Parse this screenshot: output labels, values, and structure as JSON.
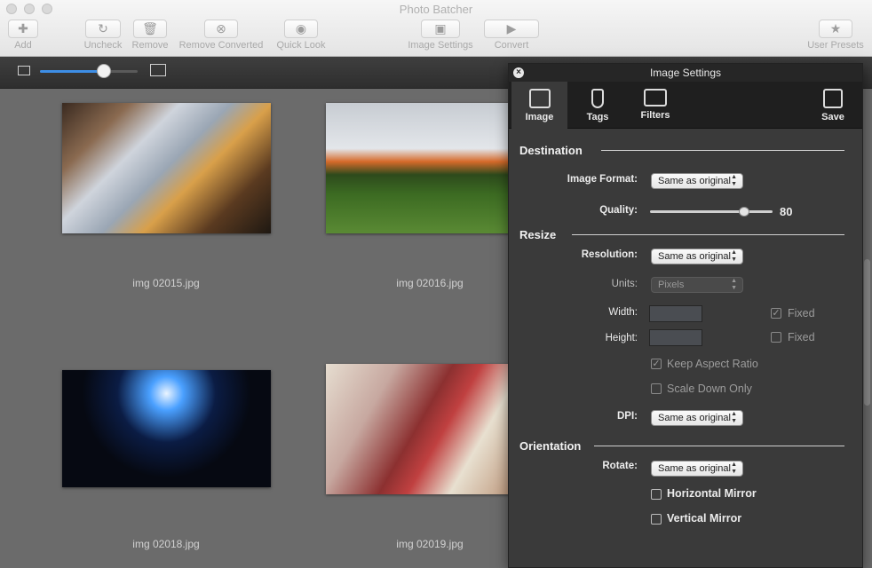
{
  "window": {
    "title": "Photo Batcher"
  },
  "toolbar": {
    "add": "Add",
    "uncheck": "Uncheck",
    "remove": "Remove",
    "remove_converted": "Remove Converted",
    "quick_look": "Quick Look",
    "image_settings": "Image Settings",
    "convert": "Convert",
    "user_presets": "User Presets"
  },
  "zoom": {
    "level": 0.65
  },
  "images": [
    {
      "name": "img 02015.jpg"
    },
    {
      "name": "img 02016.jpg"
    },
    {
      "name": "img 02018.jpg"
    },
    {
      "name": "img 02019.jpg"
    }
  ],
  "panel": {
    "title": "Image Settings",
    "tabs": {
      "image": "Image",
      "tags": "Tags",
      "filters": "Filters",
      "save": "Save"
    },
    "destination": {
      "heading": "Destination",
      "format_label": "Image Format:",
      "format_value": "Same as original",
      "quality_label": "Quality:",
      "quality_value": "80"
    },
    "resize": {
      "heading": "Resize",
      "resolution_label": "Resolution:",
      "resolution_value": "Same as original",
      "units_label": "Units:",
      "units_value": "Pixels",
      "width_label": "Width:",
      "height_label": "Height:",
      "fixed_label": "Fixed",
      "keep_aspect": "Keep Aspect Ratio",
      "scale_down": "Scale Down Only",
      "dpi_label": "DPI:",
      "dpi_value": "Same as original"
    },
    "orientation": {
      "heading": "Orientation",
      "rotate_label": "Rotate:",
      "rotate_value": "Same as original",
      "hmirror": "Horizontal Mirror",
      "vmirror": "Vertical Mirror"
    }
  }
}
